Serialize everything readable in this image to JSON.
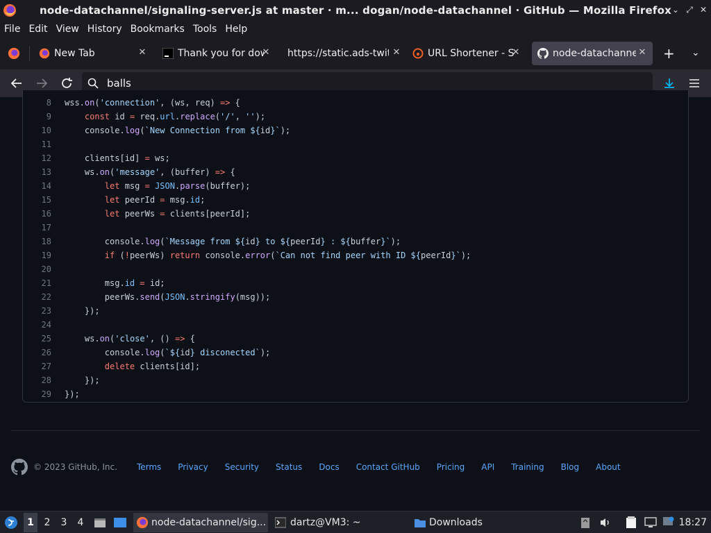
{
  "window": {
    "title": "node-datachannel/signaling-server.js at master · m...  dogan/node-datachannel · GitHub — Mozilla Firefox"
  },
  "menu": {
    "items": [
      "File",
      "Edit",
      "View",
      "History",
      "Bookmarks",
      "Tools",
      "Help"
    ]
  },
  "tabs": [
    {
      "label": "New Tab",
      "icon": "firefox-icon",
      "active": false
    },
    {
      "label": "Thank you for dow",
      "icon": "terminal-icon",
      "active": false
    },
    {
      "label": "https://static.ads-twit",
      "icon": "none",
      "active": false
    },
    {
      "label": "URL Shortener - Sl",
      "icon": "bitly-icon",
      "active": false
    },
    {
      "label": "node-datachannel",
      "icon": "github-icon",
      "active": true
    }
  ],
  "nav": {
    "url_value": "balls"
  },
  "code": {
    "lines": [
      {
        "n": "8",
        "html": "wss.<span class=\"fn\">on</span>(<span class=\"str\">'connection'</span>, (ws, req) <span class=\"kw\">=&gt;</span> {"
      },
      {
        "n": "9",
        "html": "    <span class=\"kw\">const</span> id <span class=\"kw\">=</span> req.<span class=\"cst\">url</span>.<span class=\"fn\">replace</span>(<span class=\"str\">'/'</span>, <span class=\"str\">''</span>);"
      },
      {
        "n": "10",
        "html": "    console.<span class=\"fn\">log</span>(<span class=\"str\">`New Connection from ${</span>id<span class=\"str\">}`</span>);"
      },
      {
        "n": "11",
        "html": ""
      },
      {
        "n": "12",
        "html": "    clients[id] <span class=\"kw\">=</span> ws;"
      },
      {
        "n": "13",
        "html": "    ws.<span class=\"fn\">on</span>(<span class=\"str\">'message'</span>, (buffer) <span class=\"kw\">=&gt;</span> {"
      },
      {
        "n": "14",
        "html": "        <span class=\"kw\">let</span> msg <span class=\"kw\">=</span> <span class=\"cst\">JSON</span>.<span class=\"fn\">parse</span>(buffer);"
      },
      {
        "n": "15",
        "html": "        <span class=\"kw\">let</span> peerId <span class=\"kw\">=</span> msg.<span class=\"cst\">id</span>;"
      },
      {
        "n": "16",
        "html": "        <span class=\"kw\">let</span> peerWs <span class=\"kw\">=</span> clients[peerId];"
      },
      {
        "n": "17",
        "html": ""
      },
      {
        "n": "18",
        "html": "        console.<span class=\"fn\">log</span>(<span class=\"str\">`Message from ${</span>id<span class=\"str\">} to ${</span>peerId<span class=\"str\">} : ${</span>buffer<span class=\"str\">}`</span>);"
      },
      {
        "n": "19",
        "html": "        <span class=\"kw\">if</span> (<span class=\"kw\">!</span>peerWs) <span class=\"kw\">return</span> console.<span class=\"fn\">error</span>(<span class=\"str\">`Can not find peer with ID ${</span>peerId<span class=\"str\">}`</span>);"
      },
      {
        "n": "20",
        "html": ""
      },
      {
        "n": "21",
        "html": "        msg.<span class=\"cst\">id</span> <span class=\"kw\">=</span> id;"
      },
      {
        "n": "22",
        "html": "        peerWs.<span class=\"fn\">send</span>(<span class=\"cst\">JSON</span>.<span class=\"fn\">stringify</span>(msg));"
      },
      {
        "n": "23",
        "html": "    });"
      },
      {
        "n": "24",
        "html": ""
      },
      {
        "n": "25",
        "html": "    ws.<span class=\"fn\">on</span>(<span class=\"str\">'close'</span>, () <span class=\"kw\">=&gt;</span> {"
      },
      {
        "n": "26",
        "html": "        console.<span class=\"fn\">log</span>(<span class=\"str\">`${</span>id<span class=\"str\">} disconected`</span>);"
      },
      {
        "n": "27",
        "html": "        <span class=\"kw\">delete</span> clients[id];"
      },
      {
        "n": "28",
        "html": "    });"
      },
      {
        "n": "29",
        "html": "});"
      }
    ]
  },
  "footer": {
    "copyright": "© 2023 GitHub, Inc.",
    "links": [
      "Terms",
      "Privacy",
      "Security",
      "Status",
      "Docs",
      "Contact GitHub",
      "Pricing",
      "API",
      "Training",
      "Blog",
      "About"
    ]
  },
  "taskbar": {
    "workspaces": [
      "1",
      "2",
      "3",
      "4"
    ],
    "active_workspace": "1",
    "windows": [
      {
        "label": "node-datachannel/sig...",
        "icon": "firefox-icon",
        "active": true
      },
      {
        "label": "dartz@VM3: ~",
        "icon": "terminal-icon",
        "active": false
      },
      {
        "label": "Downloads",
        "icon": "folder-icon",
        "active": false
      }
    ],
    "clock": "18:27"
  },
  "colors": {
    "accent_link": "#58a6ff",
    "active_tab": "#42414d",
    "download_icon": "#00b3f4"
  }
}
